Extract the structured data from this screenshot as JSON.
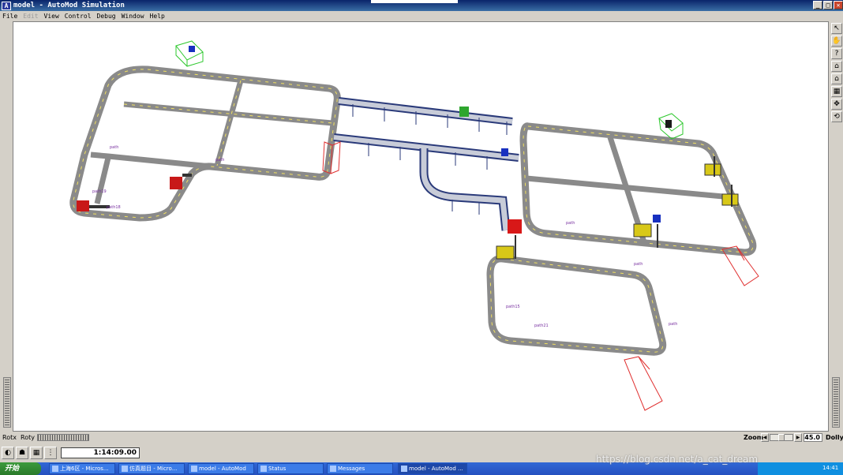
{
  "window": {
    "title": "model - AutoMod Simulation",
    "app_icon_letter": "A",
    "min_glyph": "_",
    "max_glyph": "□",
    "close_glyph": "✕"
  },
  "menu": {
    "file": "File",
    "edit": "Edit",
    "view": "View",
    "control": "Control",
    "debug": "Debug",
    "window": "Window",
    "help": "Help"
  },
  "scene": {
    "path_labels": [
      "path19",
      "path18",
      "path21",
      "path15",
      "path",
      "path",
      "path",
      "path",
      "path"
    ]
  },
  "right_tools": [
    {
      "name": "pointer-icon",
      "glyph": "↖"
    },
    {
      "name": "hand-icon",
      "glyph": "✋"
    },
    {
      "name": "help-icon",
      "glyph": "?"
    },
    {
      "name": "home-icon",
      "glyph": "⌂"
    },
    {
      "name": "home-set-icon",
      "glyph": "⌂"
    },
    {
      "name": "grid-icon",
      "glyph": "▦"
    },
    {
      "name": "move-icon",
      "glyph": "✥"
    },
    {
      "name": "rotate-icon",
      "glyph": "⟲"
    }
  ],
  "status": {
    "rotx": "Rotx",
    "roty": "Roty",
    "zoom": "Zoom",
    "zoom_value": "45.0",
    "dolly": "Dolly",
    "left_arrow": "◀",
    "right_arrow": "▶"
  },
  "bottom_toolbar": {
    "sim_time": "1:14:09.00"
  },
  "taskbar": {
    "start": "开始",
    "items": [
      "上海6区 - Micros...",
      "仿真题目 - Micro...",
      "model - AutoMod",
      "Status",
      "Messages",
      "model - AutoMod ..."
    ],
    "time": "14:41"
  },
  "watermark": "https://blog.csdn.net/a_cat_dream"
}
